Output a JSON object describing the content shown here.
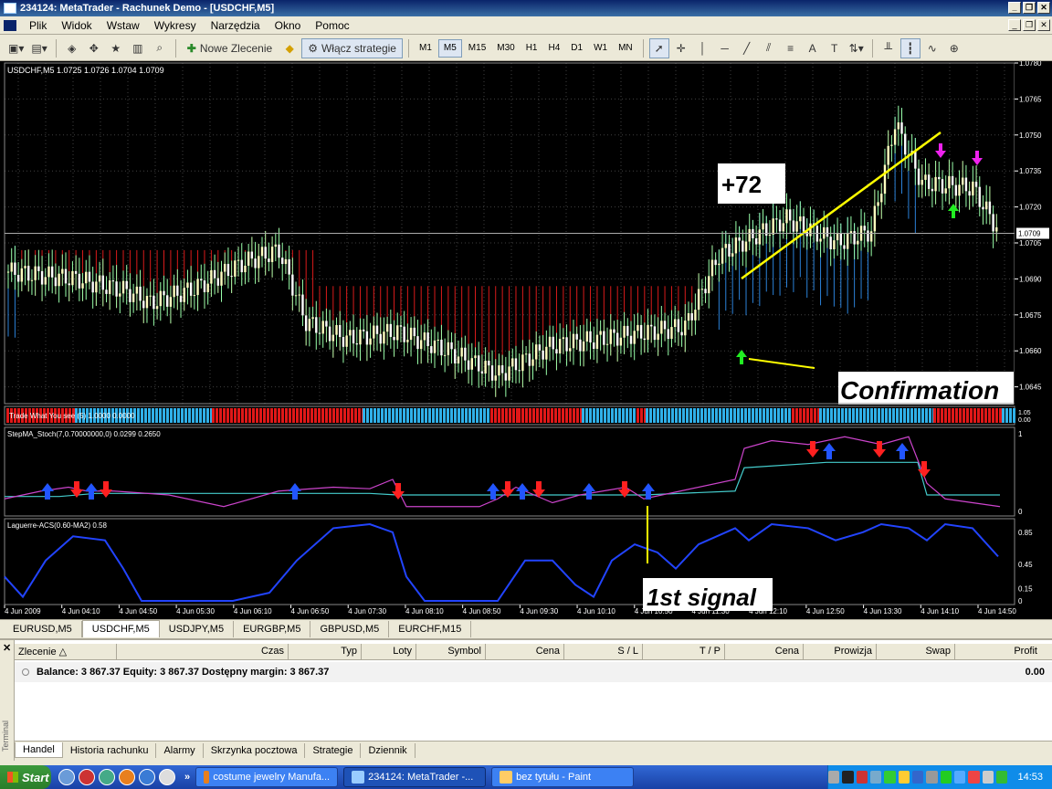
{
  "window": {
    "title": "234124: MetaTrader - Rachunek Demo - [USDCHF,M5]"
  },
  "menu": [
    "Plik",
    "Widok",
    "Wstaw",
    "Wykresy",
    "Narzędzia",
    "Okno",
    "Pomoc"
  ],
  "toolbar": {
    "new_order": "Nowe Zlecenie",
    "enable_strategies": "Włącz strategie",
    "timeframes": [
      "M1",
      "M5",
      "M15",
      "M30",
      "H1",
      "H4",
      "D1",
      "W1",
      "MN"
    ],
    "active_timeframe": "M5"
  },
  "chart": {
    "main_label": "USDCHF,M5   1.0725 1.0726 1.0704 1.0709",
    "price_axis": [
      "1.0780",
      "1.0765",
      "1.0750",
      "1.0735",
      "1.0720",
      "1.0705",
      "1.0690",
      "1.0675",
      "1.0660",
      "1.0645"
    ],
    "current_price": "1.0709",
    "annotations": {
      "plus72": "+72",
      "confirmation": "Confirmation",
      "first_signal": "1st signal"
    },
    "twys_label": "Trade What You see (5) 1.0000 0.0000",
    "twys_axis": [
      "1.05",
      "0.00"
    ],
    "stepma_label": "StepMA_Stoch(7,0.70000000,0) 0.0299 0.2650",
    "stepma_axis": [
      "1",
      "0"
    ],
    "laguerre_label": "Laguerre-ACS(0.60-MA2) 0.58",
    "laguerre_axis": [
      "0.85",
      "0.45",
      "0.15",
      "0"
    ],
    "time_axis": [
      "4 Jun 2009",
      "4 Jun 04:10",
      "4 Jun 04:50",
      "4 Jun 05:30",
      "4 Jun 06:10",
      "4 Jun 06:50",
      "4 Jun 07:30",
      "4 Jun 08:10",
      "4 Jun 08:50",
      "4 Jun 09:30",
      "4 Jun 10:10",
      "4 Jun 10:50",
      "4 Jun 11:30",
      "4 Jun 12:10",
      "4 Jun 12:50",
      "4 Jun 13:30",
      "4 Jun 14:10",
      "4 Jun 14:50"
    ]
  },
  "symbol_tabs": [
    "EURUSD,M5",
    "USDCHF,M5",
    "USDJPY,M5",
    "EURGBP,M5",
    "GBPUSD,M5",
    "EURCHF,M15"
  ],
  "active_symbol_tab": "USDCHF,M5",
  "terminal": {
    "side_label": "Terminal",
    "columns": [
      "Zlecenie",
      "Czas",
      "Typ",
      "Loty",
      "Symbol",
      "Cena",
      "S / L",
      "T / P",
      "Cena",
      "Prowizja",
      "Swap",
      "Profit"
    ],
    "balance_text": "Balance: 3 867.37  Equity: 3 867.37  Dostępny margin: 3 867.37",
    "profit": "0.00",
    "tabs": [
      "Handel",
      "Historia rachunku",
      "Alarmy",
      "Skrzynka pocztowa",
      "Strategie",
      "Dziennik"
    ],
    "active_tab": "Handel"
  },
  "taskbar": {
    "start": "Start",
    "tasks": [
      "costume jewelry Manufa...",
      "234124: MetaTrader -...",
      "bez tytułu - Paint"
    ],
    "clock": "14:53"
  },
  "colors": {
    "bull_candle": "#ffffc0",
    "bear_candle": "#ffffff",
    "bg": "#000000",
    "grid": "#404040",
    "step_up": "#3399ff",
    "step_down": "#ff2020",
    "yellow_line": "#ffff00",
    "stoch_magenta": "#cc44cc",
    "stoch_cyan": "#44cccc",
    "laguerre": "#2244ff",
    "arrow_up": "#2255ff",
    "arrow_down": "#ff2020"
  }
}
